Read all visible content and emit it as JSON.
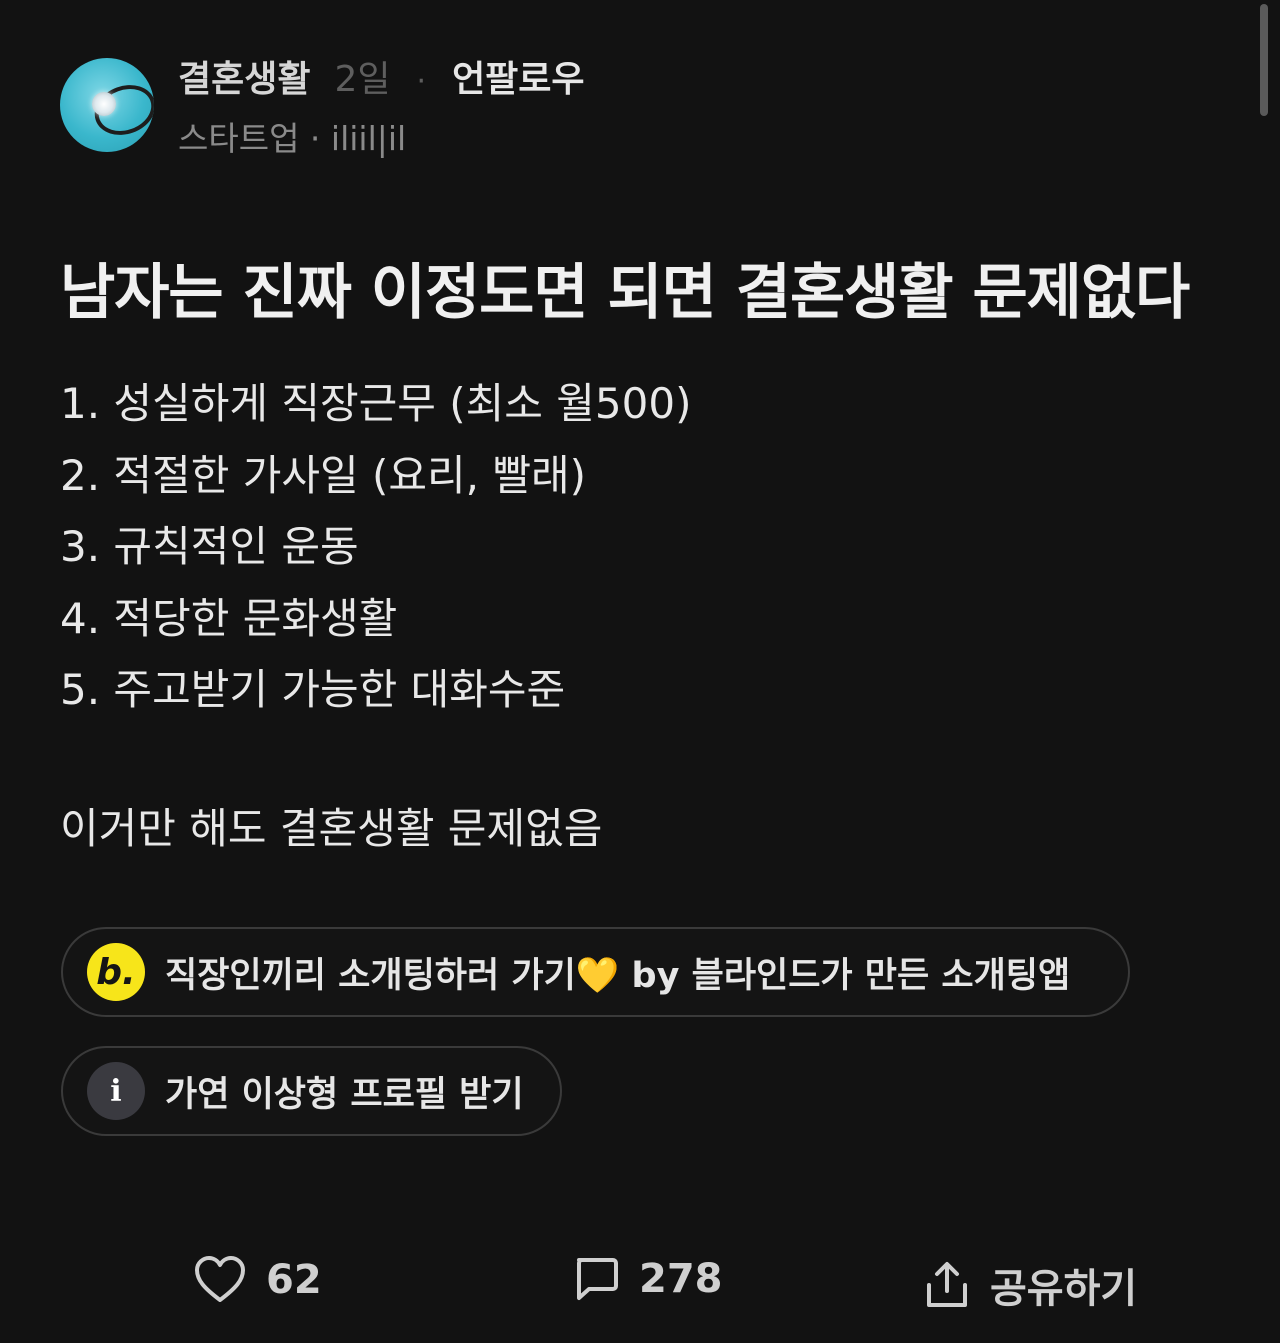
{
  "post_header": {
    "channel": "결혼생활",
    "time_ago": "2일",
    "separator": "·",
    "unfollow_label": "언팔로우",
    "author_line": "스타트업 · iliil|il"
  },
  "post": {
    "title": "남자는 진짜 이정도면 되면 결혼생활 문제없다",
    "items": [
      "1. 성실하게 직장근무 (최소 월500)",
      "2. 적절한 가사일 (요리, 빨래)",
      "3. 규칙적인 운동",
      "4. 적당한 문화생활",
      "5. 주고받기 가능한 대화수준"
    ],
    "closing": "이거만 해도 결혼생활 문제없음"
  },
  "promos": {
    "dating": {
      "icon": "b.",
      "text": "직장인끼리 소개팅하러 가기",
      "heart": "💛",
      "suffix": " by 블라인드가 만든 소개팅앱"
    },
    "profile": {
      "icon": "i",
      "text": "가연 이상형 프로필 받기"
    }
  },
  "actions": {
    "like_count": "62",
    "comment_count": "278",
    "share_label": "공유하기"
  },
  "colors": {
    "background": "#121212",
    "badge_yellow": "#f7e51a",
    "avatar_teal": "#3ab7cc"
  }
}
